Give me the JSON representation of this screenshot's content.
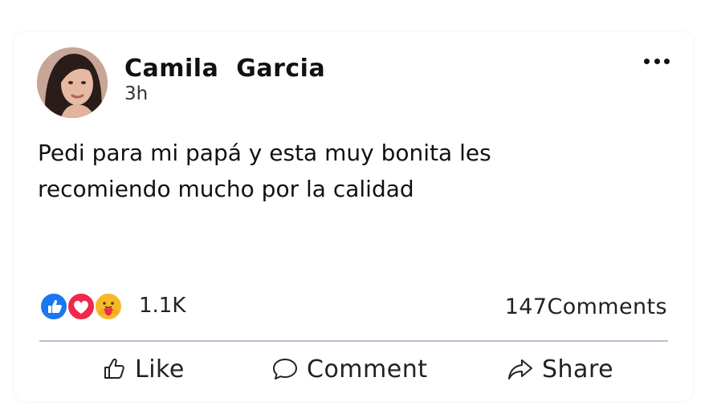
{
  "post": {
    "author_name": "Camila  Garcia",
    "time": "3h",
    "text": "Pedi para mi papá y esta muy bonita les recomiendo mucho por la calidad"
  },
  "reactions": {
    "icons": [
      "like-reaction-icon",
      "love-reaction-icon",
      "care-reaction-icon"
    ],
    "count": "1.1K"
  },
  "comments": {
    "count": "147",
    "label": "Comments"
  },
  "actions": {
    "like_label": "Like",
    "comment_label": "Comment",
    "share_label": "Share"
  },
  "colors": {
    "like_blue": "#1877F2",
    "love_red": "#F02849",
    "care_yellow": "#F7B928",
    "divider": "#B6C2D4"
  }
}
